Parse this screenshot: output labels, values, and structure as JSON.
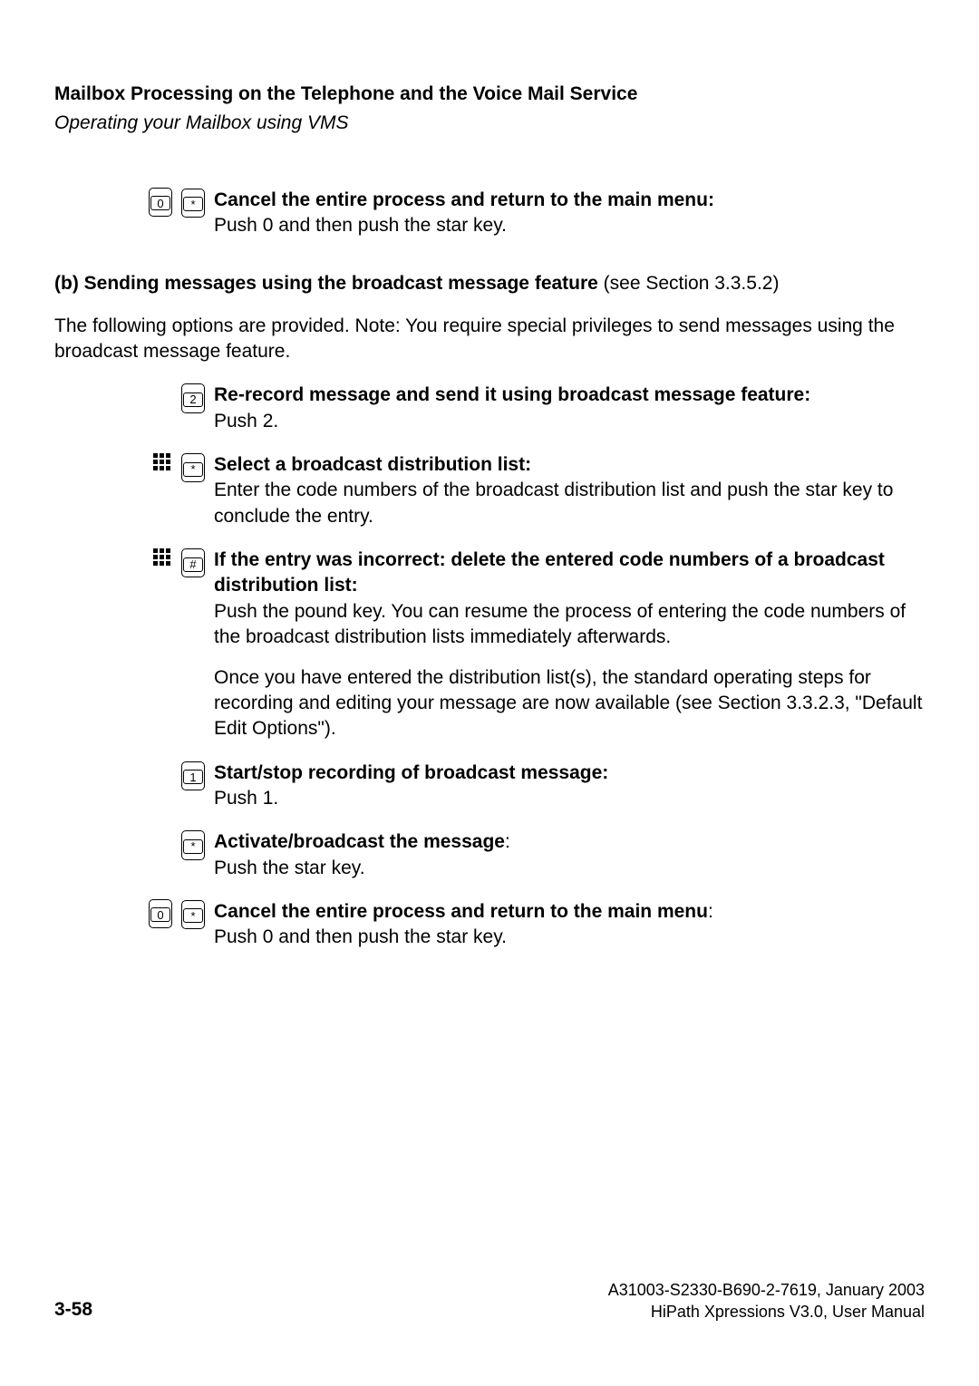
{
  "header": {
    "title": "Mailbox Processing on the Telephone and the Voice Mail Service",
    "subtitle": "Operating your Mailbox using VMS"
  },
  "instructions": [
    {
      "preIcons": [
        "key-0"
      ],
      "key": "*",
      "bold": "Cancel the entire process and return to the main menu:",
      "text": "Push 0 and then push the star key."
    }
  ],
  "sectionB": {
    "label": "(b) Sending messages using the broadcast message feature",
    "seeRef": " (see Section 3.3.5.2)",
    "intro": "The following options are provided. Note: You require special privileges to send messages using the broadcast message feature."
  },
  "instructionsB": [
    {
      "preIcons": [],
      "key": "2",
      "bold": "Re-record message and send it using broadcast message feature:",
      "text": "Push 2."
    },
    {
      "preIcons": [
        "keypad"
      ],
      "key": "*",
      "bold": "Select a broadcast distribution list:",
      "text": "Enter the code numbers of the broadcast distribution list and push the star key to conclude the entry."
    },
    {
      "preIcons": [
        "keypad"
      ],
      "key": "#",
      "bold": "If the entry was incorrect: delete the entered code numbers of a broadcast distribution list:",
      "text": "Push the pound key. You can resume the process of entering the code numbers of the broadcast distribution lists immediately afterwards.",
      "extra": "Once you have entered the distribution list(s), the standard operating steps for recording and editing your message are now available (see Section 3.3.2.3, \"Default Edit Options\")."
    },
    {
      "preIcons": [],
      "key": "1",
      "bold": "Start/stop recording of broadcast message:",
      "text": "Push 1."
    },
    {
      "preIcons": [],
      "key": "*",
      "bold": "Activate/broadcast the message",
      "boldSuffix": ":",
      "text": "Push the star key."
    },
    {
      "preIcons": [
        "key-0"
      ],
      "key": "*",
      "bold": "Cancel the entire process and return to the main menu",
      "boldSuffix": ":",
      "text": "Push 0 and then push the star key."
    }
  ],
  "footer": {
    "page": "3-58",
    "doc1": "A31003-S2330-B690-2-7619, January 2003",
    "doc2": "HiPath Xpressions V3.0, User Manual"
  },
  "keys": {
    "0": "0",
    "1": "1",
    "2": "2",
    "star": "*",
    "hash": "#"
  }
}
